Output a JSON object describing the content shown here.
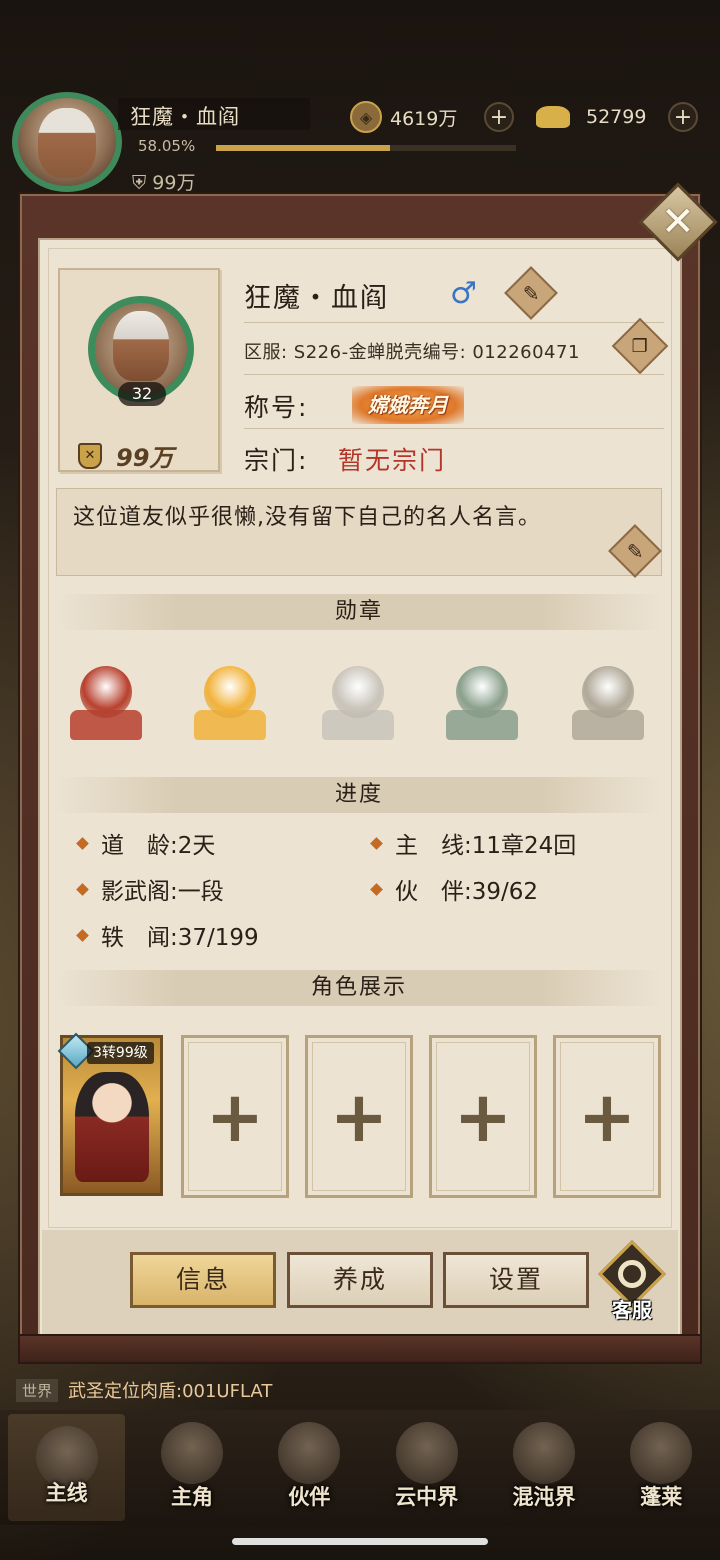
{
  "hud": {
    "player_name": "狂魔・血阎",
    "exp_percent": "58.05%",
    "exp_fraction": 0.5805,
    "power": "99万",
    "avatar_level": "32",
    "copper": "4619万",
    "gold": "52799"
  },
  "profile": {
    "name": "狂魔・血阎",
    "gender_symbol": "♂",
    "level": "32",
    "power": "99万",
    "server_text": "区服: S226-金蝉脱壳编号: 012260471",
    "title_label": "称号:",
    "title_badge": "嫦娥奔月",
    "sect_label": "宗门:",
    "sect_value": "暂无宗门",
    "motto": "这位道友似乎很懒,没有留下自己的名人名言。"
  },
  "sections": {
    "medals": "勋章",
    "progress": "进度",
    "showcase": "角色展示"
  },
  "medals": [
    {
      "name": "treasure-medal",
      "color": "#b8402e"
    },
    {
      "name": "goddess-medal",
      "color": "#f2b23a"
    },
    {
      "name": "palace-medal",
      "color": "#c9c4ba"
    },
    {
      "name": "beast-medal",
      "color": "#8aa08c"
    },
    {
      "name": "sage-medal",
      "color": "#b0a898"
    }
  ],
  "progress": {
    "dao_age": "道　龄:2天",
    "main_line": "主　线:11章24回",
    "shadow_pavilion": "影武阁:一段",
    "partners": "伙　伴:39/62",
    "anecdotes": "轶　闻:37/199"
  },
  "showcase": {
    "filled_level": "3转99级",
    "plus": "+"
  },
  "tabs": {
    "info": "信息",
    "cultivate": "养成",
    "settings": "设置",
    "service": "客服"
  },
  "chat": {
    "channel": "世界",
    "message": "武圣定位肉盾:001UFLAT"
  },
  "nav": [
    {
      "label": "主线"
    },
    {
      "label": "主角"
    },
    {
      "label": "伙伴"
    },
    {
      "label": "云中界"
    },
    {
      "label": "混沌界"
    },
    {
      "label": "蓬莱"
    }
  ]
}
